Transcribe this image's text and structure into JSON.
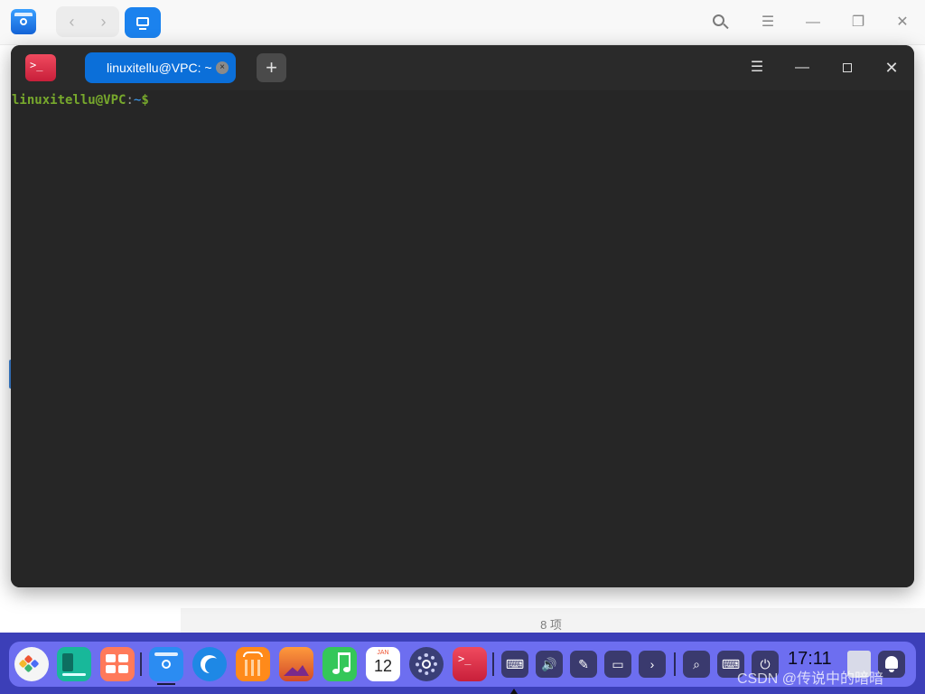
{
  "file_manager": {
    "status_text": "8 项",
    "nav": {
      "back": "‹",
      "forward": "›"
    },
    "controls": {
      "menu": "☰",
      "minimize": "—",
      "restore": "❐",
      "close": "✕"
    }
  },
  "terminal": {
    "app_icon_text": ">_",
    "tab_label": "linuxitellu@VPC: ~",
    "tab_close": "×",
    "new_tab": "+",
    "controls": {
      "menu": "☰",
      "minimize": "—",
      "close": "✕"
    },
    "prompt": {
      "user_host": "linuxitellu@VPC",
      "separator": ":",
      "dir": "~",
      "symbol": "$"
    }
  },
  "dock": {
    "apps": [
      {
        "name": "launcher",
        "color": "#f5f5f5"
      },
      {
        "name": "multitask-view",
        "color": "#18b89a"
      },
      {
        "name": "app-store-grid",
        "color": "#ff7a5a"
      },
      {
        "name": "file-manager",
        "color": "#2b8cf2"
      },
      {
        "name": "browser",
        "color": "#1e88e5"
      },
      {
        "name": "app-store",
        "color": "#ff8a1a"
      },
      {
        "name": "image-viewer",
        "color": "#f28a2a"
      },
      {
        "name": "music",
        "color": "#34c759"
      },
      {
        "name": "calendar",
        "color": "#ffffff"
      },
      {
        "name": "settings",
        "color": "#3a3f77"
      },
      {
        "name": "terminal",
        "color": "#e03048"
      }
    ],
    "calendar": {
      "month": "JAN",
      "day": "12"
    },
    "tray": [
      "⌨",
      "🔊",
      "✎",
      "▭",
      "›",
      "⌕",
      "⌨",
      "⏻"
    ],
    "clock": "17:11",
    "watermark": "CSDN @传说中的暗暗"
  }
}
